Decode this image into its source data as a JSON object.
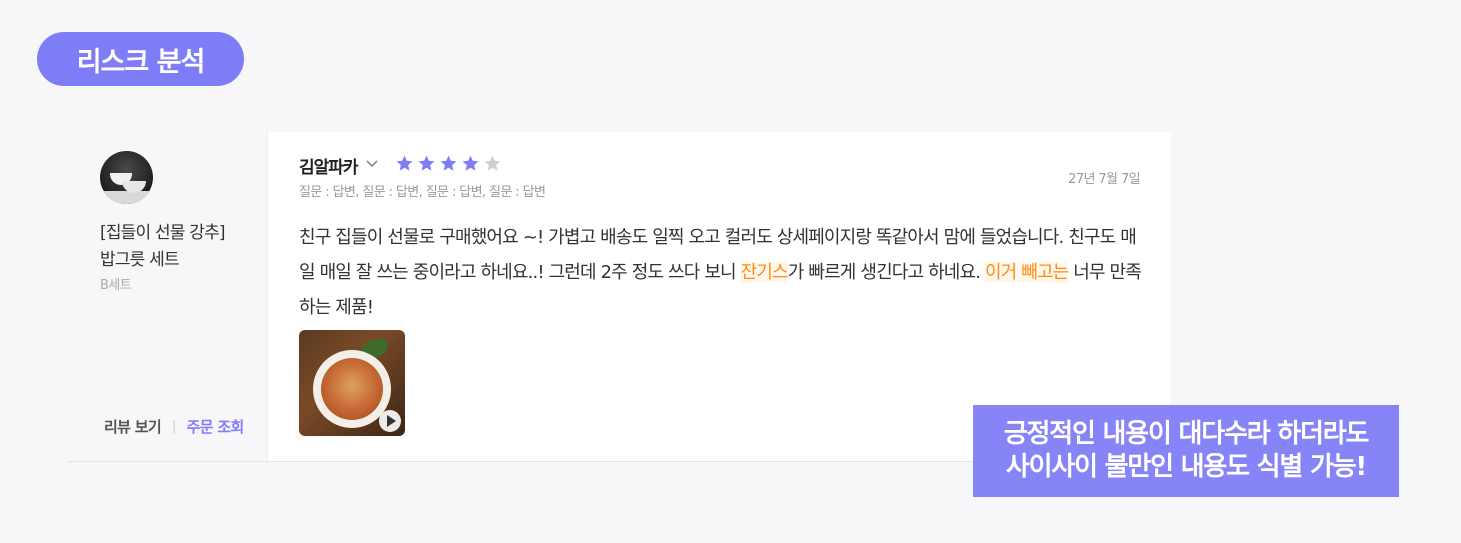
{
  "badge": {
    "label": "리스크 분석"
  },
  "product": {
    "name_line1": "[집들이 선물 강추]",
    "name_line2": "밥그릇 세트",
    "option": "B세트",
    "image_icon": "bowls-photo"
  },
  "left_links": {
    "view_review": "리뷰 보기",
    "separator": "|",
    "order_lookup": "주문 조회"
  },
  "review": {
    "author": "김알파카",
    "rating": 4,
    "rating_max": 5,
    "star_color": "#7f7cf7",
    "star_empty_color": "#cfcfd6",
    "qa_line": "질문 : 답변, 질문 : 답변, 질문 : 답변, 질문 : 답변",
    "date": "27년 7월 7일",
    "text_part1": "친구 집들이 선물로 구매했어요 ~! 가볍고 배송도 일찍 오고 컬러도 상세페이지랑 똑같아서 맘에 들었습니다. 친구도 매일 매일 잘 쓰는 중이라고 하네요..! 그런데 2주 정도 쓰다 보니 ",
    "highlight1": "잔기스",
    "text_part2": "가 빠르게 생긴다고 하네요. ",
    "highlight2": "이거 빼고는",
    "text_part3": " 너무 만족하는 제품!",
    "highlight_color": "#ff8c1a",
    "media_icon": "food-video-thumbnail",
    "play_icon": "play-icon"
  },
  "callout": {
    "line1": "긍정적인 내용이 대다수라 하더라도",
    "line2": "사이사이 불만인 내용도 식별 가능!",
    "color": "#8784f7"
  }
}
